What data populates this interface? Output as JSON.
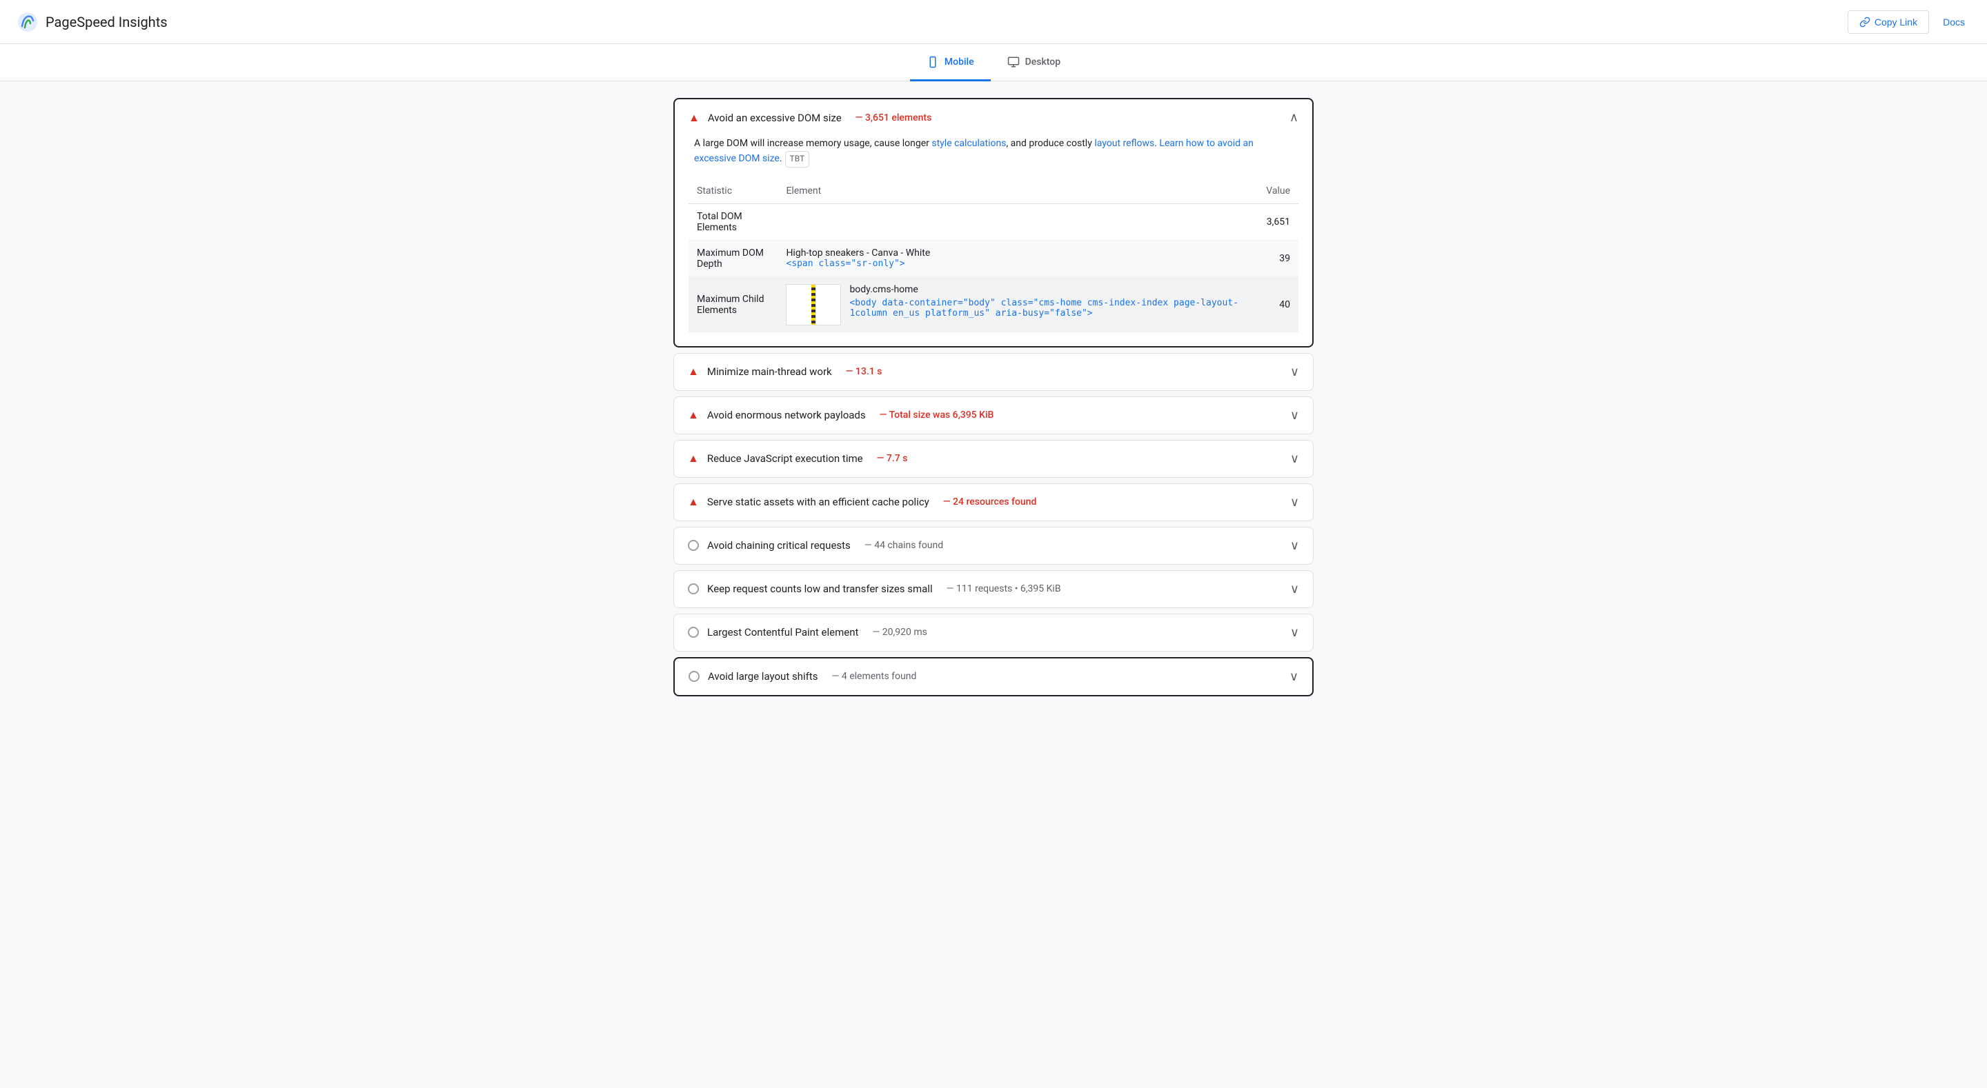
{
  "header": {
    "logo_text": "PageSpeed Insights",
    "copy_link_label": "Copy Link",
    "docs_label": "Docs"
  },
  "tabs": [
    {
      "id": "mobile",
      "label": "Mobile",
      "active": true
    },
    {
      "id": "desktop",
      "label": "Desktop",
      "active": false
    }
  ],
  "audits": [
    {
      "id": "dom-size",
      "expanded": true,
      "icon": "error",
      "title": "Avoid an excessive DOM size",
      "value": "— 3,651 elements",
      "value_type": "red",
      "description_parts": [
        "A large DOM will increase memory usage, cause longer ",
        "style calculations",
        ", and produce costly ",
        "layout reflows",
        ". ",
        "Learn how to avoid an excessive DOM size",
        ".",
        " TBT"
      ],
      "table": {
        "columns": [
          "Statistic",
          "Element",
          "Value"
        ],
        "rows": [
          {
            "statistic": "Total DOM Elements",
            "element": "",
            "value": "3,651",
            "shaded": false
          },
          {
            "statistic": "Maximum DOM Depth",
            "element_text": "High-top sneakers - Canva - White",
            "element_code": "<span class=\"sr-only\">",
            "value": "39",
            "shaded": true
          },
          {
            "statistic": "Maximum Child Elements",
            "element_text": "body.cms-home",
            "element_code": "<body data-container=\"body\" class=\"cms-home cms-index-index page-layout-1column en_us platform_us\" aria-busy=\"false\">",
            "value": "40",
            "shaded": false,
            "has_thumb": true
          }
        ]
      }
    },
    {
      "id": "main-thread",
      "expanded": false,
      "icon": "error",
      "title": "Minimize main-thread work",
      "value": "— 13.1 s",
      "value_type": "red"
    },
    {
      "id": "network-payloads",
      "expanded": false,
      "icon": "error",
      "title": "Avoid enormous network payloads",
      "value": "— Total size was 6,395 KiB",
      "value_type": "red"
    },
    {
      "id": "js-execution",
      "expanded": false,
      "icon": "error",
      "title": "Reduce JavaScript execution time",
      "value": "— 7.7 s",
      "value_type": "red"
    },
    {
      "id": "cache-policy",
      "expanded": false,
      "icon": "error",
      "title": "Serve static assets with an efficient cache policy",
      "value": "— 24 resources found",
      "value_type": "red"
    },
    {
      "id": "critical-requests",
      "expanded": false,
      "icon": "neutral",
      "title": "Avoid chaining critical requests",
      "value": "— 44 chains found",
      "value_type": "gray"
    },
    {
      "id": "request-counts",
      "expanded": false,
      "icon": "neutral",
      "title": "Keep request counts low and transfer sizes small",
      "value": "— 111 requests • 6,395 KiB",
      "value_type": "gray"
    },
    {
      "id": "lcp-element",
      "expanded": false,
      "icon": "neutral",
      "title": "Largest Contentful Paint element",
      "value": "— 20,920 ms",
      "value_type": "gray"
    },
    {
      "id": "layout-shifts",
      "expanded": false,
      "icon": "neutral",
      "title": "Avoid large layout shifts",
      "value": "— 4 elements found",
      "value_type": "gray"
    }
  ]
}
